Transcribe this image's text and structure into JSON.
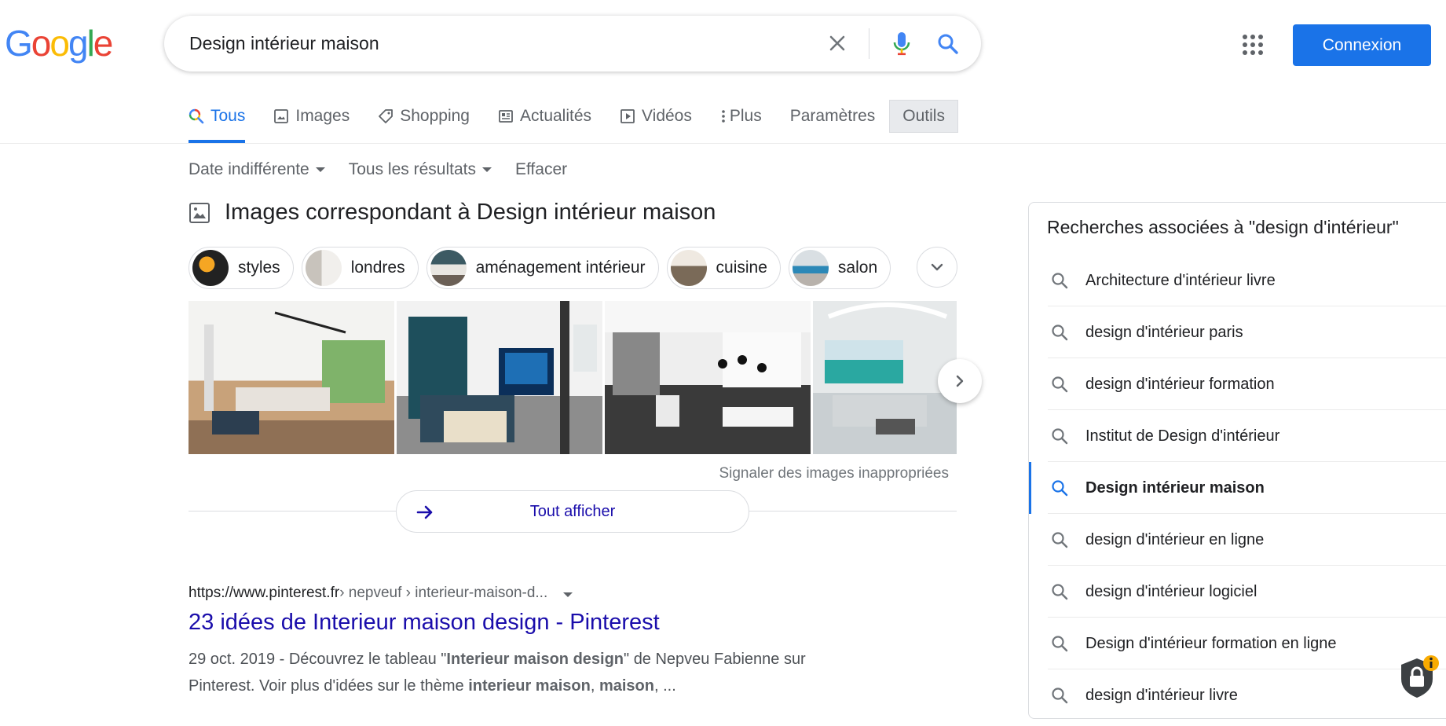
{
  "logo": {
    "text": [
      "G",
      "o",
      "o",
      "g",
      "l",
      "e"
    ],
    "colors": [
      "#4285F4",
      "#EA4335",
      "#FBBC05",
      "#4285F4",
      "#34A853",
      "#EA4335"
    ]
  },
  "search": {
    "value": "Design intérieur maison",
    "placeholder": ""
  },
  "header": {
    "signin_label": "Connexion",
    "accent_color": "#1a73e8"
  },
  "tabs": [
    {
      "label": "Tous",
      "icon": "search-multicolor-icon",
      "active": true
    },
    {
      "label": "Images",
      "icon": "image-icon"
    },
    {
      "label": "Shopping",
      "icon": "tag-icon"
    },
    {
      "label": "Actualités",
      "icon": "newspaper-icon"
    },
    {
      "label": "Vidéos",
      "icon": "play-icon"
    },
    {
      "label": "Plus",
      "icon": "vertical-dots-icon"
    },
    {
      "label": "Paramètres"
    },
    {
      "label": "Outils"
    }
  ],
  "tools": {
    "date": "Date indifférente",
    "results": "Tous les résultats",
    "clear": "Effacer"
  },
  "images_section": {
    "heading": "Images correspondant à Design intérieur maison",
    "chips": [
      "styles",
      "londres",
      "aménagement intérieur",
      "cuisine",
      "salon"
    ],
    "report_link": "Signaler des images inappropriées",
    "show_all": "Tout afficher"
  },
  "result": {
    "url_host": "https://www.pinterest.fr",
    "url_path": " › nepveuf › interieur-maison-d...",
    "title": "23 idées de Interieur maison design - Pinterest",
    "snippet": {
      "line1_pre": "29 oct. 2019 - Découvrez le tableau \"",
      "line1_bold": "Interieur maison design",
      "line1_post": "\" de Nepveu Fabienne sur",
      "line2_pre": "Pinterest. Voir plus d'idées sur le thème ",
      "line2_bold1": "interieur maison",
      "line2_mid": ", ",
      "line2_bold2": "maison",
      "line2_post": ", ..."
    }
  },
  "related": {
    "title": "Recherches associées à \"design d'intérieur\"",
    "items": [
      "Architecture d'intérieur livre",
      "design d'intérieur paris",
      "design d'intérieur formation",
      "Institut de Design d'intérieur",
      "Design intérieur maison",
      "design d'intérieur en ligne",
      "design d'intérieur logiciel",
      "Design d'intérieur formation en ligne",
      "design d'intérieur livre"
    ],
    "active_index": 4
  }
}
